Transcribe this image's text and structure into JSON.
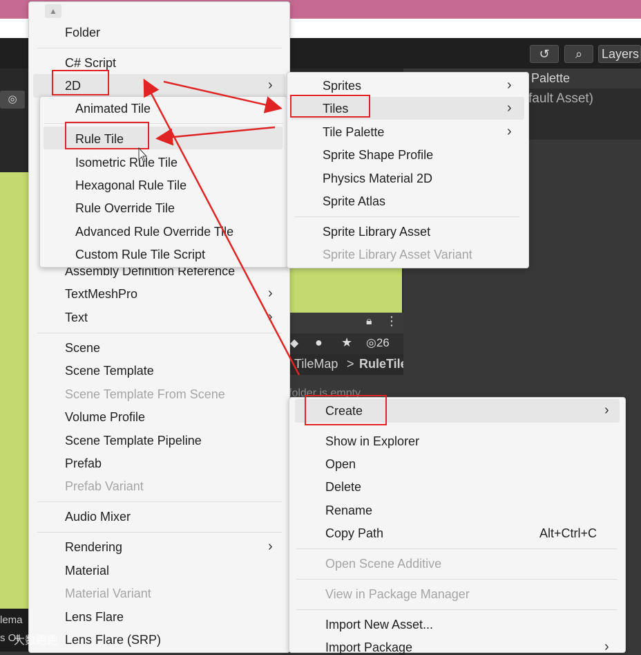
{
  "toolbar": {
    "layers_label": "Layers",
    "history_icon": "history-icon",
    "search_icon": "search-icon"
  },
  "inspector": {
    "tab_label": "Palette",
    "subtitle": "fault Asset)"
  },
  "project": {
    "count_label": "26",
    "breadcrumb_a": "TileMap",
    "breadcrumb_sep": ">",
    "breadcrumb_b": "RuleTile",
    "empty_text": "folder is empty"
  },
  "left_strip": {
    "text_a": "lema",
    "text_b": "s Ot",
    "watermark": "大数跑跑"
  },
  "create_menu": {
    "items": [
      {
        "label": "Folder"
      },
      {
        "label": "C# Script"
      },
      {
        "label": "2D"
      },
      {
        "label": "Assembly Definition Reference"
      },
      {
        "label": "TextMeshPro"
      },
      {
        "label": "Text"
      },
      {
        "label": "Scene"
      },
      {
        "label": "Scene Template"
      },
      {
        "label": "Scene Template From Scene"
      },
      {
        "label": "Volume Profile"
      },
      {
        "label": "Scene Template Pipeline"
      },
      {
        "label": "Prefab"
      },
      {
        "label": "Prefab Variant"
      },
      {
        "label": "Audio Mixer"
      },
      {
        "label": "Rendering"
      },
      {
        "label": "Material"
      },
      {
        "label": "Material Variant"
      },
      {
        "label": "Lens Flare"
      },
      {
        "label": "Lens Flare (SRP)"
      }
    ]
  },
  "tiles_menu": {
    "items": [
      {
        "label": "Animated Tile"
      },
      {
        "label": "Rule Tile"
      },
      {
        "label": "Isometric Rule Tile"
      },
      {
        "label": "Hexagonal Rule Tile"
      },
      {
        "label": "Rule Override Tile"
      },
      {
        "label": "Advanced Rule Override Tile"
      },
      {
        "label": "Custom Rule Tile Script"
      }
    ]
  },
  "twod_menu": {
    "items": [
      {
        "label": "Sprites"
      },
      {
        "label": "Tiles"
      },
      {
        "label": "Tile Palette"
      },
      {
        "label": "Sprite Shape Profile"
      },
      {
        "label": "Physics Material 2D"
      },
      {
        "label": "Sprite Atlas"
      },
      {
        "label": "Sprite Library Asset"
      },
      {
        "label": "Sprite Library Asset Variant"
      }
    ]
  },
  "context_menu": {
    "items": [
      {
        "label": "Create"
      },
      {
        "label": "Show in Explorer"
      },
      {
        "label": "Open"
      },
      {
        "label": "Delete"
      },
      {
        "label": "Rename"
      },
      {
        "label": "Copy Path",
        "shortcut": "Alt+Ctrl+C"
      },
      {
        "label": "Open Scene Additive"
      },
      {
        "label": "View in Package Manager"
      },
      {
        "label": "Import New Asset..."
      },
      {
        "label": "Import Package"
      }
    ]
  },
  "colors": {
    "highlight_red": "#e02424",
    "menu_bg": "#f5f5f5",
    "scene_green": "#c4d96f",
    "title_pink": "#c56a91"
  }
}
